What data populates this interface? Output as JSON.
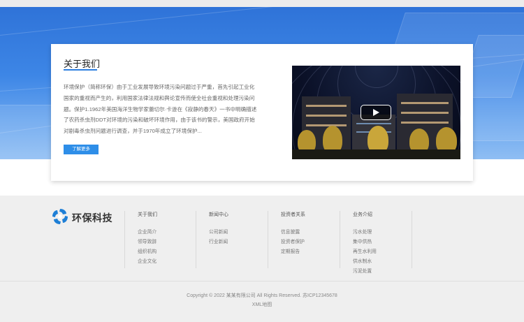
{
  "about": {
    "title": "关于我们",
    "body": "环境保护（简称环保）由于工业发展导致环境污染问题过于严重，首先引起工业化国家的重视而产生的，利用国家法律法规和舆论宣传而使全社会重视和处理污染问题。保护1.1962年美国海洋生物学家蕾切尔·卡逊在《寂静的春天》一书中明确描述了农药杀虫剂DDT对环境的污染和破坏环境作用，由于该书的警示，美国政府开始对剧毒杀虫剂问题进行调查，并于1970年成立了环境保护...",
    "more_label": "了解更多"
  },
  "footer": {
    "brand": "环保科技",
    "columns": [
      {
        "title": "关于我们",
        "items": [
          "企业简介",
          "领导致辞",
          "组织机构",
          "企业文化"
        ]
      },
      {
        "title": "新闻中心",
        "items": [
          "公司新闻",
          "行业新闻"
        ]
      },
      {
        "title": "投资者关系",
        "items": [
          "信息披露",
          "投资者保护",
          "定期报告"
        ]
      },
      {
        "title": "业务介绍",
        "items": [
          "污水处理",
          "集中供热",
          "再生水利用",
          "供水制水",
          "污泥处置"
        ]
      }
    ],
    "copyright": "Copyright © 2022 某某有限公司 All Rights Reserved. 苏ICP12345678",
    "sitemap": "XML地图"
  },
  "colors": {
    "accent": "#2d7ee0",
    "button": "#2e8ee8",
    "hero": "#3d86e6"
  },
  "icons": {
    "play": "play-icon",
    "logo": "swirl-logo-icon"
  }
}
